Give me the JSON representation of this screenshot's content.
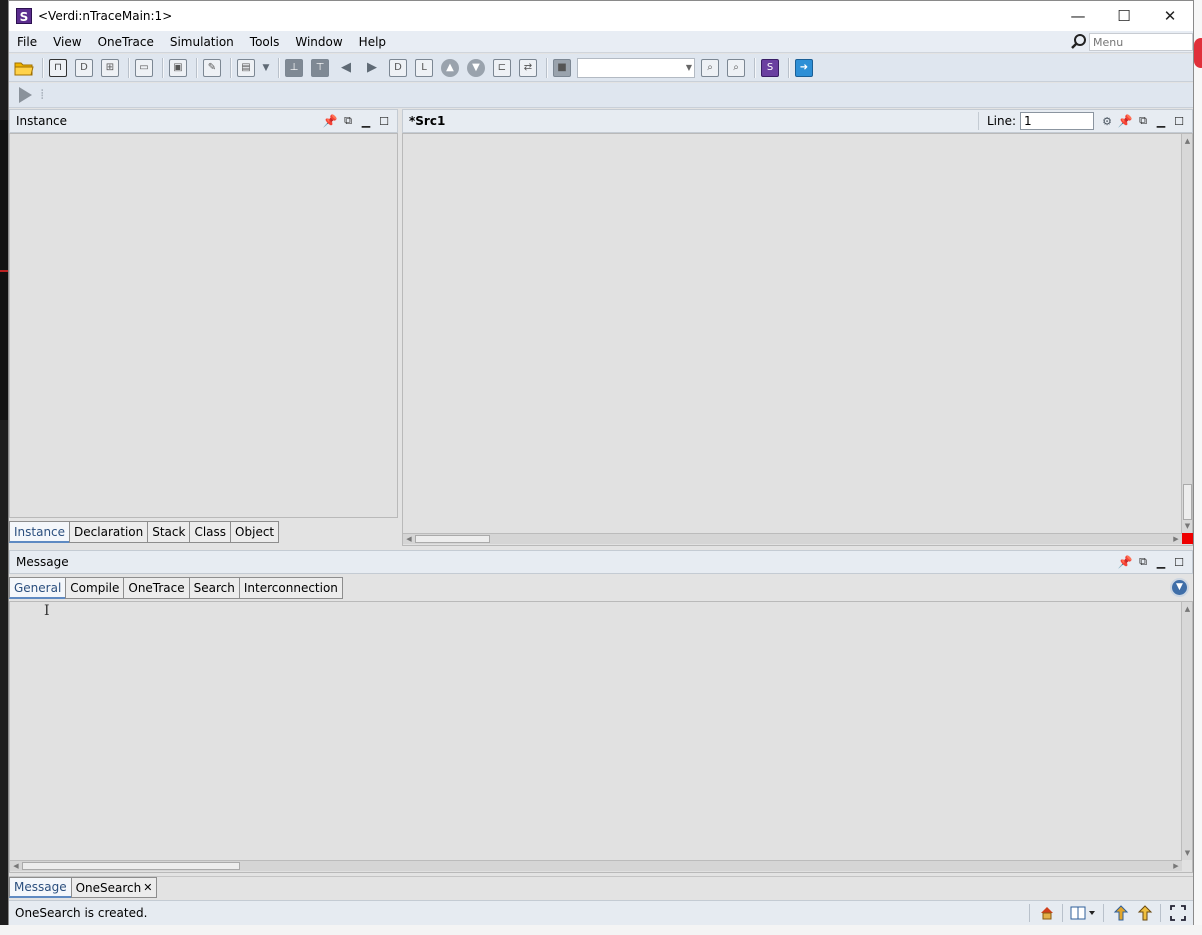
{
  "window": {
    "title": "<Verdi:nTraceMain:1>",
    "app_icon_letter": "S",
    "controls": {
      "minimize": "—",
      "maximize": "☐",
      "close": "✕"
    }
  },
  "menubar": {
    "items": [
      {
        "label": "File",
        "mnemonic": "F"
      },
      {
        "label": "View",
        "mnemonic": "V"
      },
      {
        "label": "OneTrace",
        "mnemonic": "T"
      },
      {
        "label": "Simulation",
        "mnemonic": "S"
      },
      {
        "label": "Tools",
        "mnemonic": "o"
      },
      {
        "label": "Window",
        "mnemonic": "W"
      },
      {
        "label": "Help",
        "mnemonic": "H"
      }
    ],
    "search_placeholder": "Menu"
  },
  "instance_panel": {
    "title": "Instance",
    "tabs": [
      "Instance",
      "Declaration",
      "Stack",
      "Class",
      "Object"
    ],
    "active_tab": "Instance"
  },
  "source_panel": {
    "title": "*Src1",
    "line_label": "Line:",
    "line_value": "1"
  },
  "message_panel": {
    "title": "Message",
    "tabs": [
      "General",
      "Compile",
      "OneTrace",
      "Search",
      "Interconnection"
    ],
    "active_tab": "General"
  },
  "bottom_tabs": {
    "tabs": [
      "Message",
      "OneSearch"
    ],
    "close_glyph": "✕"
  },
  "statusbar": {
    "text": "OneSearch is created."
  },
  "toolbar2": {
    "separator": "⁞"
  },
  "colors": {
    "panel_header": "#e7ecf2",
    "toolbar": "#dfe6ef",
    "content": "#e1e1e1",
    "active_tab_text": "#2b4f7e",
    "pin_blue": "#2f6db5",
    "red_marker": "#ee0000"
  }
}
